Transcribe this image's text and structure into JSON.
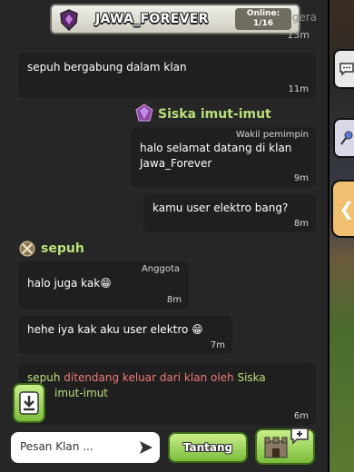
{
  "header": {
    "clan_name": "JAWA_FOREVER",
    "online_label": "Online:",
    "online_count": "1/16",
    "partial_sender": "gera",
    "partial_time": "13m"
  },
  "messages": [
    {
      "type": "system",
      "text": "sepuh bergabung dalam klan",
      "time": "11m"
    },
    {
      "type": "user",
      "sender": "Siska imut-imut",
      "role": "Wakil pemimpin",
      "text": "halo selamat datang di klan Jawa_Forever",
      "time": "9m"
    },
    {
      "type": "user",
      "sender": "",
      "role": "",
      "text": "kamu user elektro bang?",
      "time": "8m"
    },
    {
      "type": "user",
      "sender": "sepuh",
      "role": "Anggota",
      "text": "halo juga kak😁",
      "time": "8m"
    },
    {
      "type": "user",
      "sender": "",
      "role": "",
      "text": "hehe iya kak aku user elektro 😁",
      "time": "7m"
    },
    {
      "type": "system",
      "text_name1": "sepuh",
      "text_mid": " ditendang keluar dari klan oleh ",
      "text_name2": "Siska",
      "text_rest": "imut-imut",
      "time": "6m"
    }
  ],
  "bottom": {
    "input_placeholder": "Pesan Klan ...",
    "challenge_label": "Tantang"
  },
  "side": {
    "arrow_label": "❮"
  },
  "colors": {
    "accent_green": "#b8e07a",
    "kick_red": "#f07a7a",
    "button_green": "#7bbd3a"
  }
}
